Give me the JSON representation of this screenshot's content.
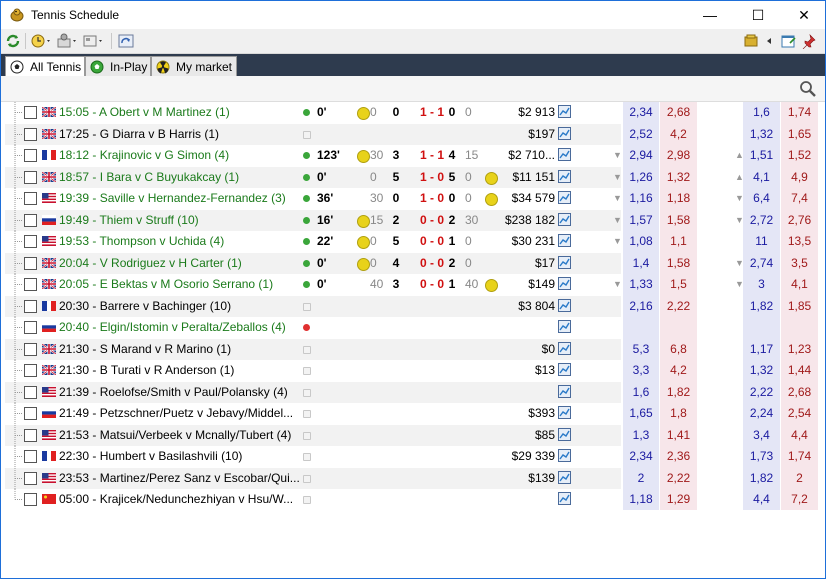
{
  "window": {
    "title": "Tennis Schedule",
    "minimize": "—",
    "maximize": "☐",
    "close": "✕"
  },
  "tabs": [
    {
      "label": "All Tennis",
      "active": true
    },
    {
      "label": "In-Play",
      "active": false
    },
    {
      "label": "My market",
      "active": false
    }
  ],
  "colors": {
    "back": "#e4e6f6",
    "lay": "#f7e6ea",
    "live_text": "#1a7a1a",
    "score": "#d01010"
  },
  "rows": [
    {
      "flag": "gb",
      "time_match": "15:05 - A Obert v M Martinez (1)",
      "live": true,
      "status": "green",
      "minute": "0'",
      "ball": "left",
      "g1": "0",
      "s1": "0",
      "sets": "1 - 1",
      "s2": "0",
      "g2": "0",
      "matched": "$2 913",
      "arrow_l": "",
      "back1": "2,34",
      "lay1": "2,68",
      "arrow_r": "",
      "back2": "1,6",
      "lay2": "1,74"
    },
    {
      "flag": "gb",
      "time_match": "17:25 - G Diarra v B Harris (1)",
      "live": false,
      "status": "none",
      "minute": "",
      "ball": "",
      "g1": "",
      "s1": "",
      "sets": "",
      "s2": "",
      "g2": "",
      "matched": "$197",
      "arrow_l": "",
      "back1": "2,52",
      "lay1": "4,2",
      "arrow_r": "",
      "back2": "1,32",
      "lay2": "1,65"
    },
    {
      "flag": "fr",
      "time_match": "18:12 - Krajinovic v G Simon (4)",
      "live": true,
      "status": "green",
      "minute": "123'",
      "ball": "left",
      "g1": "30",
      "s1": "3",
      "sets": "1 - 1",
      "s2": "4",
      "g2": "15",
      "matched": "$2 710...",
      "arrow_l": "down",
      "back1": "2,94",
      "lay1": "2,98",
      "arrow_r": "up",
      "back2": "1,51",
      "lay2": "1,52"
    },
    {
      "flag": "gb",
      "time_match": "18:57 - I Bara v C Buyukakcay (1)",
      "live": true,
      "status": "green",
      "minute": "0'",
      "ball": "right",
      "g1": "0",
      "s1": "5",
      "sets": "1 - 0",
      "s2": "5",
      "g2": "0",
      "matched": "$11 151",
      "arrow_l": "down",
      "back1": "1,26",
      "lay1": "1,32",
      "arrow_r": "up",
      "back2": "4,1",
      "lay2": "4,9"
    },
    {
      "flag": "us",
      "time_match": "19:39 - Saville v Hernandez-Fernandez (3)",
      "live": true,
      "status": "green",
      "minute": "36'",
      "ball": "right",
      "g1": "30",
      "s1": "0",
      "sets": "1 - 0",
      "s2": "0",
      "g2": "0",
      "matched": "$34 579",
      "arrow_l": "down",
      "back1": "1,16",
      "lay1": "1,18",
      "arrow_r": "down",
      "back2": "6,4",
      "lay2": "7,4"
    },
    {
      "flag": "ru",
      "time_match": "19:49 - Thiem v Struff (10)",
      "live": true,
      "status": "green",
      "minute": "16'",
      "ball": "left",
      "g1": "15",
      "s1": "2",
      "sets": "0 - 0",
      "s2": "2",
      "g2": "30",
      "matched": "$238 182",
      "arrow_l": "down",
      "back1": "1,57",
      "lay1": "1,58",
      "arrow_r": "down",
      "back2": "2,72",
      "lay2": "2,76"
    },
    {
      "flag": "us",
      "time_match": "19:53 - Thompson v Uchida (4)",
      "live": true,
      "status": "green",
      "minute": "22'",
      "ball": "left",
      "g1": "0",
      "s1": "5",
      "sets": "0 - 0",
      "s2": "1",
      "g2": "0",
      "matched": "$30 231",
      "arrow_l": "down",
      "back1": "1,08",
      "lay1": "1,1",
      "arrow_r": "",
      "back2": "11",
      "lay2": "13,5"
    },
    {
      "flag": "gb",
      "time_match": "20:04 - V Rodriguez v H Carter (1)",
      "live": true,
      "status": "green",
      "minute": "0'",
      "ball": "left",
      "g1": "0",
      "s1": "4",
      "sets": "0 - 0",
      "s2": "2",
      "g2": "0",
      "matched": "$17",
      "arrow_l": "",
      "back1": "1,4",
      "lay1": "1,58",
      "arrow_r": "down",
      "back2": "2,74",
      "lay2": "3,5"
    },
    {
      "flag": "gb",
      "time_match": "20:05 - E Bektas v M Osorio Serrano (1)",
      "live": true,
      "status": "green",
      "minute": "0'",
      "ball": "right",
      "g1": "40",
      "s1": "3",
      "sets": "0 - 0",
      "s2": "1",
      "g2": "40",
      "matched": "$149",
      "arrow_l": "down",
      "back1": "1,33",
      "lay1": "1,5",
      "arrow_r": "down",
      "back2": "3",
      "lay2": "4,1"
    },
    {
      "flag": "fr",
      "time_match": "20:30 - Barrere v Bachinger (10)",
      "live": false,
      "status": "none",
      "minute": "",
      "ball": "",
      "g1": "",
      "s1": "",
      "sets": "",
      "s2": "",
      "g2": "",
      "matched": "$3 804",
      "arrow_l": "",
      "back1": "2,16",
      "lay1": "2,22",
      "arrow_r": "",
      "back2": "1,82",
      "lay2": "1,85"
    },
    {
      "flag": "ru",
      "time_match": "20:40 - Elgin/Istomin v Peralta/Zeballos (4)",
      "live": true,
      "status": "red",
      "minute": "",
      "ball": "",
      "g1": "",
      "s1": "",
      "sets": "",
      "s2": "",
      "g2": "",
      "matched": "",
      "arrow_l": "",
      "back1": "",
      "lay1": "",
      "arrow_r": "",
      "back2": "",
      "lay2": ""
    },
    {
      "flag": "gb",
      "time_match": "21:30 - S Marand v R Marino (1)",
      "live": false,
      "status": "none",
      "minute": "",
      "ball": "",
      "g1": "",
      "s1": "",
      "sets": "",
      "s2": "",
      "g2": "",
      "matched": "$0",
      "arrow_l": "",
      "back1": "5,3",
      "lay1": "6,8",
      "arrow_r": "",
      "back2": "1,17",
      "lay2": "1,23"
    },
    {
      "flag": "gb",
      "time_match": "21:30 - B Turati v R Anderson (1)",
      "live": false,
      "status": "none",
      "minute": "",
      "ball": "",
      "g1": "",
      "s1": "",
      "sets": "",
      "s2": "",
      "g2": "",
      "matched": "$13",
      "arrow_l": "",
      "back1": "3,3",
      "lay1": "4,2",
      "arrow_r": "",
      "back2": "1,32",
      "lay2": "1,44"
    },
    {
      "flag": "us",
      "time_match": "21:39 - Roelofse/Smith v Paul/Polansky (4)",
      "live": false,
      "status": "none",
      "minute": "",
      "ball": "",
      "g1": "",
      "s1": "",
      "sets": "",
      "s2": "",
      "g2": "",
      "matched": "",
      "arrow_l": "",
      "back1": "1,6",
      "lay1": "1,82",
      "arrow_r": "",
      "back2": "2,22",
      "lay2": "2,68"
    },
    {
      "flag": "ru",
      "time_match": "21:49 - Petzschner/Puetz v Jebavy/Middel...",
      "live": false,
      "status": "none",
      "minute": "",
      "ball": "",
      "g1": "",
      "s1": "",
      "sets": "",
      "s2": "",
      "g2": "",
      "matched": "$393",
      "arrow_l": "",
      "back1": "1,65",
      "lay1": "1,8",
      "arrow_r": "",
      "back2": "2,24",
      "lay2": "2,54"
    },
    {
      "flag": "us",
      "time_match": "21:53 - Matsui/Verbeek v Mcnally/Tubert (4)",
      "live": false,
      "status": "none",
      "minute": "",
      "ball": "",
      "g1": "",
      "s1": "",
      "sets": "",
      "s2": "",
      "g2": "",
      "matched": "$85",
      "arrow_l": "",
      "back1": "1,3",
      "lay1": "1,41",
      "arrow_r": "",
      "back2": "3,4",
      "lay2": "4,4"
    },
    {
      "flag": "fr",
      "time_match": "22:30 - Humbert v Basilashvili (10)",
      "live": false,
      "status": "none",
      "minute": "",
      "ball": "",
      "g1": "",
      "s1": "",
      "sets": "",
      "s2": "",
      "g2": "",
      "matched": "$29 339",
      "arrow_l": "",
      "back1": "2,34",
      "lay1": "2,36",
      "arrow_r": "",
      "back2": "1,73",
      "lay2": "1,74"
    },
    {
      "flag": "us",
      "time_match": "23:53 - Martinez/Perez Sanz v Escobar/Qui...",
      "live": false,
      "status": "none",
      "minute": "",
      "ball": "",
      "g1": "",
      "s1": "",
      "sets": "",
      "s2": "",
      "g2": "",
      "matched": "$139",
      "arrow_l": "",
      "back1": "2",
      "lay1": "2,22",
      "arrow_r": "",
      "back2": "1,82",
      "lay2": "2"
    },
    {
      "flag": "cn",
      "time_match": "05:00 - Krajicek/Nedunchezhiyan v Hsu/W...",
      "live": false,
      "status": "none",
      "minute": "",
      "ball": "",
      "g1": "",
      "s1": "",
      "sets": "",
      "s2": "",
      "g2": "",
      "matched": "",
      "arrow_l": "",
      "back1": "1,18",
      "lay1": "1,29",
      "arrow_r": "",
      "back2": "4,4",
      "lay2": "7,2"
    }
  ]
}
